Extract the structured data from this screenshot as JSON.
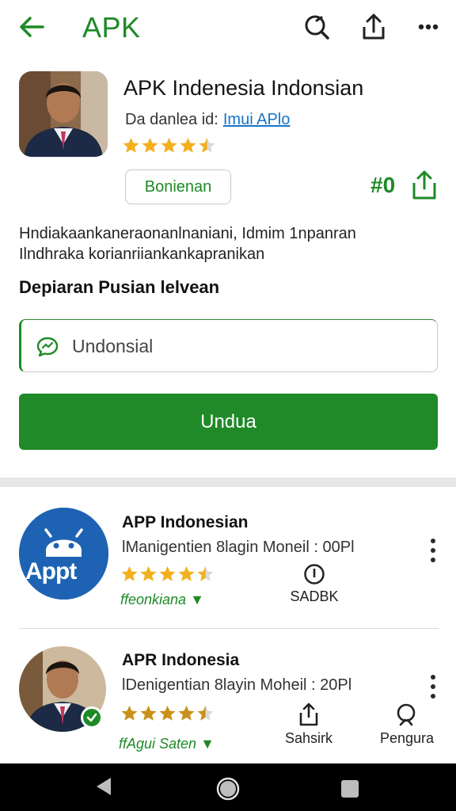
{
  "appbar": {
    "title": "APK",
    "icons": [
      "back-arrow-icon",
      "search-icon",
      "share-icon",
      "more-icon"
    ]
  },
  "hero": {
    "name": "APK Indenesia Indonsian",
    "dev_label": "Da danlea id:",
    "dev_link": "Imui APlo",
    "rating": 4.5,
    "tag": "Bonienan",
    "count": "#0"
  },
  "description": {
    "line1": "Hndiakaankaneraonanlnaniani, Idmim 1npanran",
    "line2": "Ilndhraka korianriiankankapranikan"
  },
  "section_title": "Depiaran Pusian lelvean",
  "search": {
    "value": "Undonsial"
  },
  "cta": {
    "label": "Undua"
  },
  "list": [
    {
      "name": "APP Indonesian",
      "sub": "lManigentien 8lagin Moneil : 00Pl",
      "rating": 4.5,
      "tag": "ffeonkiana",
      "badge_label": "SADBK",
      "logo_text": "Appt"
    },
    {
      "name": "APR Indonesia",
      "sub": "lDenigentian 8layin Moheil : 20Pl",
      "rating": 4.5,
      "tag": "ffAgui Saten",
      "action1": "Sahsirk",
      "action2": "Pengura"
    }
  ],
  "colors": {
    "accent": "#1f8a27",
    "star": "#f2b01e",
    "link": "#1a73c8"
  }
}
